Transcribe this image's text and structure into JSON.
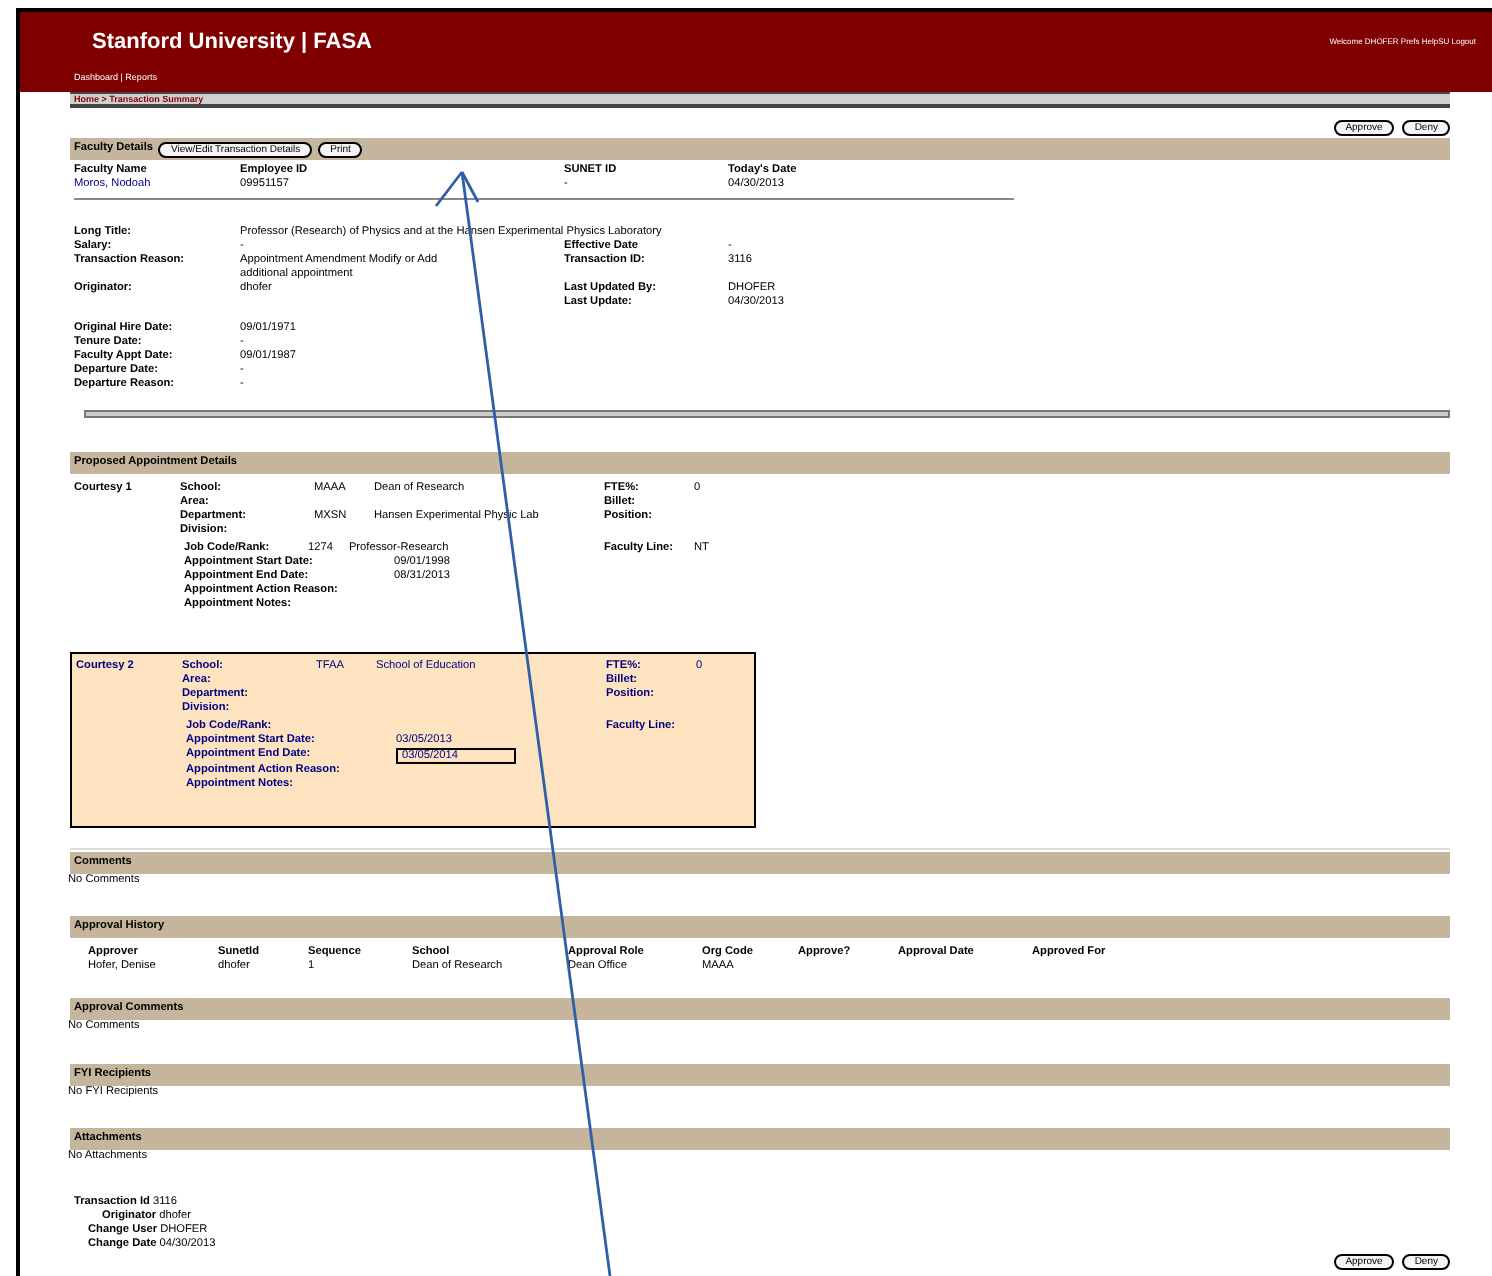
{
  "header": {
    "title": "Stanford University | FASA",
    "user_links": "Welcome DHOFER Prefs HelpSU Logout",
    "nav": "Dashboard | Reports",
    "breadcrumb": "Home > Transaction Summary"
  },
  "top_actions": [
    "Approve",
    "Deny"
  ],
  "faculty_details": {
    "title": "Faculty Details",
    "buttons": [
      "View/Edit Transaction Details",
      "Print"
    ],
    "summary": [
      {
        "label": "Faculty Name",
        "value": "Moros, Nodoah"
      },
      {
        "label": "Employee ID",
        "value": "09951157"
      },
      {
        "label": "SUNET ID",
        "value": "-"
      },
      {
        "label": "Today's Date",
        "value": "04/30/2013"
      }
    ],
    "groups": [
      [
        {
          "left": {
            "label": "Long Title:",
            "value": "Professor (Research) of Physics and at the Hansen Experimental Physics Laboratory"
          }
        },
        {
          "left": {
            "label": "Salary:",
            "value": "-"
          },
          "right": {
            "label": "Effective Date",
            "value": "-"
          }
        },
        {
          "left": {
            "label": "Transaction Reason:",
            "value": "Appointment Amendment Modify or Add additional appointment"
          },
          "right": {
            "label": "Transaction ID:",
            "value": "3116"
          }
        },
        {
          "left": {
            "label": "Originator:",
            "value": "dhofer"
          },
          "right": {
            "label": "Last Updated By:",
            "value": "DHOFER"
          }
        },
        {
          "right": {
            "label": "Last Update:",
            "value": "04/30/2013"
          }
        }
      ],
      [
        {
          "left": {
            "label": "Original Hire Date:",
            "value": "09/01/1971"
          }
        },
        {
          "left": {
            "label": "Tenure Date:",
            "value": "-"
          }
        },
        {
          "left": {
            "label": "Faculty Appt Date:",
            "value": "09/01/1987"
          }
        },
        {
          "left": {
            "label": "Departure Date:",
            "value": "-"
          }
        },
        {
          "left": {
            "label": "Departure Reason:",
            "value": "-"
          }
        }
      ]
    ]
  },
  "proposed": {
    "title": "Proposed Appointment Details",
    "courtesies": [
      {
        "title": "Courtesy 1",
        "highlighted": false,
        "rows": [
          {
            "label": "School:",
            "code": "MAAA",
            "value": "Dean of Research",
            "label2": "FTE%:",
            "value2": "0"
          },
          {
            "label": "Area:",
            "label2": "Billet:"
          },
          {
            "label": "Department:",
            "code": "MXSN",
            "value": "Hansen Experimental Physic Lab",
            "label2": "Position:"
          },
          {
            "label": "Division:"
          }
        ],
        "rows2": [
          {
            "label": "Job Code/Rank:",
            "code": "1274",
            "value": "Professor-Research",
            "label2": "Faculty Line:",
            "value2": "NT"
          },
          {
            "label": "Appointment Start Date:",
            "value": "09/01/1998"
          },
          {
            "label": "Appointment End Date:",
            "value": "08/31/2013"
          },
          {
            "label": "Appointment Action Reason:"
          },
          {
            "label": "Appointment Notes:"
          }
        ]
      },
      {
        "title": "Courtesy 2",
        "highlighted": true,
        "rows": [
          {
            "label": "School:",
            "code": "TFAA",
            "value": "School of Education",
            "label2": "FTE%:",
            "value2": "0"
          },
          {
            "label": "Area:",
            "label2": "Billet:"
          },
          {
            "label": "Department:",
            "label2": "Position:"
          },
          {
            "label": "Division:"
          }
        ],
        "rows2": [
          {
            "label": "Job Code/Rank:",
            "label2": "Faculty Line:"
          },
          {
            "label": "Appointment Start Date:",
            "value": "03/05/2013"
          },
          {
            "label": "Appointment End Date:",
            "value": "03/05/2014",
            "kind": "input"
          },
          {
            "label": "Appointment Action Reason:"
          },
          {
            "label": "Appointment Notes:"
          }
        ]
      }
    ]
  },
  "sections": [
    {
      "title": "Comments",
      "kind": "note",
      "text": "No Comments"
    },
    {
      "title": "Approval History",
      "kind": "table",
      "columns": [
        "Approver",
        "SunetId",
        "Sequence",
        "School",
        "Approval Role",
        "Org Code",
        "Approve?",
        "Approval Date",
        "Approved For"
      ],
      "rows": [
        [
          "Hofer, Denise",
          "dhofer",
          "1",
          "Dean of Research",
          "Dean Office",
          "MAAA",
          "",
          "",
          ""
        ]
      ]
    },
    {
      "title": "Approval Comments",
      "kind": "note",
      "text": "No Comments"
    },
    {
      "title": "FYI Recipients",
      "kind": "note",
      "text": "No FYI Recipients"
    },
    {
      "title": "Attachments",
      "kind": "note",
      "text": "No Attachments"
    }
  ],
  "transaction_info": [
    {
      "kind": "title",
      "label": "Transaction Id",
      "value": "3116"
    },
    {
      "kind": "sub",
      "label": "Originator",
      "value": "dhofer"
    },
    {
      "kind": "detail",
      "label": "Change User",
      "value": "DHOFER"
    },
    {
      "kind": "detail",
      "label": "Change Date",
      "value": "04/30/2013"
    }
  ],
  "bottom_actions": [
    "Approve",
    "Deny"
  ]
}
